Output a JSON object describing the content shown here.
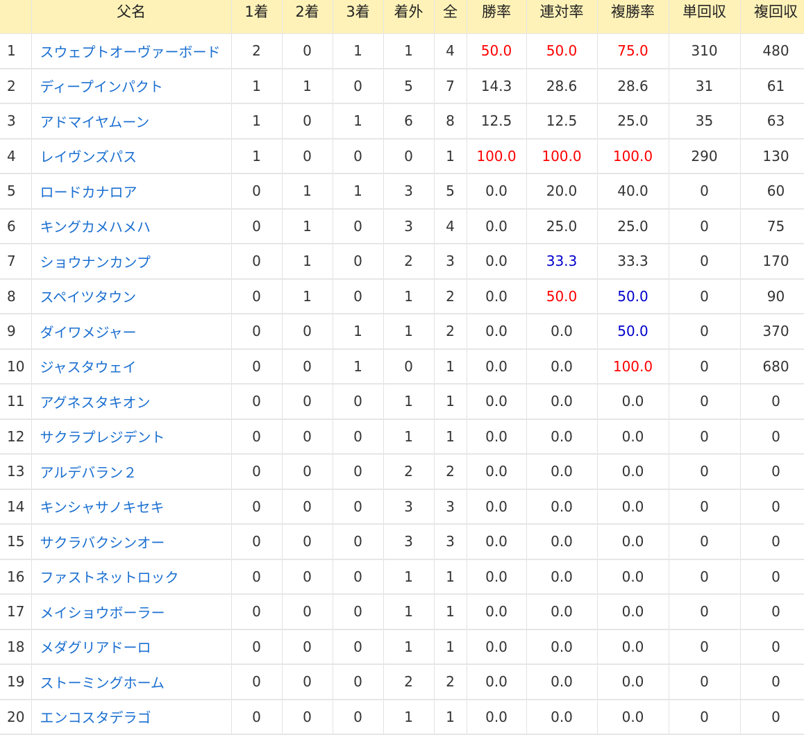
{
  "headers": [
    "",
    "父名",
    "1着",
    "2着",
    "3着",
    "着外",
    "全",
    "勝率",
    "連対率",
    "複勝率",
    "単回収",
    "複回収"
  ],
  "colors": {
    "header_bg": "#fff2b8",
    "link": "#1a6fd1",
    "high": "#ff0000",
    "mid": "#0000cc"
  },
  "rows": [
    {
      "rank": "1",
      "name": "スウェプトオーヴァーボード",
      "c1": "2",
      "c2": "0",
      "c3": "1",
      "out": "1",
      "all": "4",
      "win": "50.0",
      "win_c": "red",
      "place2": "50.0",
      "place2_c": "red",
      "show": "75.0",
      "show_c": "red",
      "ret_win": "310",
      "ret_show": "480"
    },
    {
      "rank": "2",
      "name": "ディープインパクト",
      "c1": "1",
      "c2": "1",
      "c3": "0",
      "out": "5",
      "all": "7",
      "win": "14.3",
      "win_c": "",
      "place2": "28.6",
      "place2_c": "",
      "show": "28.6",
      "show_c": "",
      "ret_win": "31",
      "ret_show": "61"
    },
    {
      "rank": "3",
      "name": "アドマイヤムーン",
      "c1": "1",
      "c2": "0",
      "c3": "1",
      "out": "6",
      "all": "8",
      "win": "12.5",
      "win_c": "",
      "place2": "12.5",
      "place2_c": "",
      "show": "25.0",
      "show_c": "",
      "ret_win": "35",
      "ret_show": "63"
    },
    {
      "rank": "4",
      "name": "レイヴンズパス",
      "c1": "1",
      "c2": "0",
      "c3": "0",
      "out": "0",
      "all": "1",
      "win": "100.0",
      "win_c": "red",
      "place2": "100.0",
      "place2_c": "red",
      "show": "100.0",
      "show_c": "red",
      "ret_win": "290",
      "ret_show": "130"
    },
    {
      "rank": "5",
      "name": "ロードカナロア",
      "c1": "0",
      "c2": "1",
      "c3": "1",
      "out": "3",
      "all": "5",
      "win": "0.0",
      "win_c": "",
      "place2": "20.0",
      "place2_c": "",
      "show": "40.0",
      "show_c": "",
      "ret_win": "0",
      "ret_show": "60"
    },
    {
      "rank": "6",
      "name": "キングカメハメハ",
      "c1": "0",
      "c2": "1",
      "c3": "0",
      "out": "3",
      "all": "4",
      "win": "0.0",
      "win_c": "",
      "place2": "25.0",
      "place2_c": "",
      "show": "25.0",
      "show_c": "",
      "ret_win": "0",
      "ret_show": "75"
    },
    {
      "rank": "7",
      "name": "ショウナンカンプ",
      "c1": "0",
      "c2": "1",
      "c3": "0",
      "out": "2",
      "all": "3",
      "win": "0.0",
      "win_c": "",
      "place2": "33.3",
      "place2_c": "blue",
      "show": "33.3",
      "show_c": "",
      "ret_win": "0",
      "ret_show": "170"
    },
    {
      "rank": "8",
      "name": "スペイツタウン",
      "c1": "0",
      "c2": "1",
      "c3": "0",
      "out": "1",
      "all": "2",
      "win": "0.0",
      "win_c": "",
      "place2": "50.0",
      "place2_c": "red",
      "show": "50.0",
      "show_c": "blue",
      "ret_win": "0",
      "ret_show": "90"
    },
    {
      "rank": "9",
      "name": "ダイワメジャー",
      "c1": "0",
      "c2": "0",
      "c3": "1",
      "out": "1",
      "all": "2",
      "win": "0.0",
      "win_c": "",
      "place2": "0.0",
      "place2_c": "",
      "show": "50.0",
      "show_c": "blue",
      "ret_win": "0",
      "ret_show": "370"
    },
    {
      "rank": "10",
      "name": "ジャスタウェイ",
      "c1": "0",
      "c2": "0",
      "c3": "1",
      "out": "0",
      "all": "1",
      "win": "0.0",
      "win_c": "",
      "place2": "0.0",
      "place2_c": "",
      "show": "100.0",
      "show_c": "red",
      "ret_win": "0",
      "ret_show": "680"
    },
    {
      "rank": "11",
      "name": "アグネスタキオン",
      "c1": "0",
      "c2": "0",
      "c3": "0",
      "out": "1",
      "all": "1",
      "win": "0.0",
      "win_c": "",
      "place2": "0.0",
      "place2_c": "",
      "show": "0.0",
      "show_c": "",
      "ret_win": "0",
      "ret_show": "0"
    },
    {
      "rank": "12",
      "name": "サクラプレジデント",
      "c1": "0",
      "c2": "0",
      "c3": "0",
      "out": "1",
      "all": "1",
      "win": "0.0",
      "win_c": "",
      "place2": "0.0",
      "place2_c": "",
      "show": "0.0",
      "show_c": "",
      "ret_win": "0",
      "ret_show": "0"
    },
    {
      "rank": "13",
      "name": "アルデバラン２",
      "c1": "0",
      "c2": "0",
      "c3": "0",
      "out": "2",
      "all": "2",
      "win": "0.0",
      "win_c": "",
      "place2": "0.0",
      "place2_c": "",
      "show": "0.0",
      "show_c": "",
      "ret_win": "0",
      "ret_show": "0"
    },
    {
      "rank": "14",
      "name": "キンシャサノキセキ",
      "c1": "0",
      "c2": "0",
      "c3": "0",
      "out": "3",
      "all": "3",
      "win": "0.0",
      "win_c": "",
      "place2": "0.0",
      "place2_c": "",
      "show": "0.0",
      "show_c": "",
      "ret_win": "0",
      "ret_show": "0"
    },
    {
      "rank": "15",
      "name": "サクラバクシンオー",
      "c1": "0",
      "c2": "0",
      "c3": "0",
      "out": "3",
      "all": "3",
      "win": "0.0",
      "win_c": "",
      "place2": "0.0",
      "place2_c": "",
      "show": "0.0",
      "show_c": "",
      "ret_win": "0",
      "ret_show": "0"
    },
    {
      "rank": "16",
      "name": "ファストネットロック",
      "c1": "0",
      "c2": "0",
      "c3": "0",
      "out": "1",
      "all": "1",
      "win": "0.0",
      "win_c": "",
      "place2": "0.0",
      "place2_c": "",
      "show": "0.0",
      "show_c": "",
      "ret_win": "0",
      "ret_show": "0"
    },
    {
      "rank": "17",
      "name": "メイショウボーラー",
      "c1": "0",
      "c2": "0",
      "c3": "0",
      "out": "1",
      "all": "1",
      "win": "0.0",
      "win_c": "",
      "place2": "0.0",
      "place2_c": "",
      "show": "0.0",
      "show_c": "",
      "ret_win": "0",
      "ret_show": "0"
    },
    {
      "rank": "18",
      "name": "メダグリアドーロ",
      "c1": "0",
      "c2": "0",
      "c3": "0",
      "out": "1",
      "all": "1",
      "win": "0.0",
      "win_c": "",
      "place2": "0.0",
      "place2_c": "",
      "show": "0.0",
      "show_c": "",
      "ret_win": "0",
      "ret_show": "0"
    },
    {
      "rank": "19",
      "name": "ストーミングホーム",
      "c1": "0",
      "c2": "0",
      "c3": "0",
      "out": "2",
      "all": "2",
      "win": "0.0",
      "win_c": "",
      "place2": "0.0",
      "place2_c": "",
      "show": "0.0",
      "show_c": "",
      "ret_win": "0",
      "ret_show": "0"
    },
    {
      "rank": "20",
      "name": "エンコスタデラゴ",
      "c1": "0",
      "c2": "0",
      "c3": "0",
      "out": "1",
      "all": "1",
      "win": "0.0",
      "win_c": "",
      "place2": "0.0",
      "place2_c": "",
      "show": "0.0",
      "show_c": "",
      "ret_win": "0",
      "ret_show": "0"
    }
  ]
}
